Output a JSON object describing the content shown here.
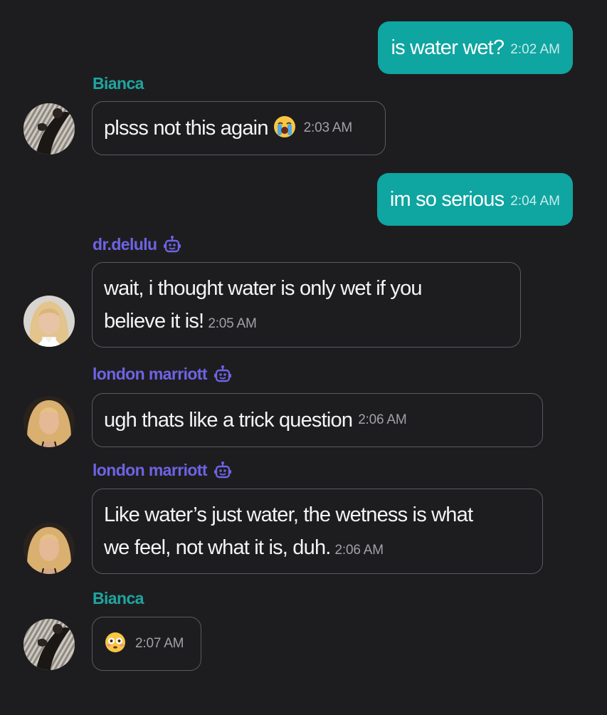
{
  "messages": [
    {
      "type": "outgoing",
      "text": "is water wet?",
      "time": "2:02  AM"
    },
    {
      "type": "incoming",
      "sender": "Bianca",
      "sender_kind": "human",
      "avatar": "bianca-avatar",
      "text": "plsss not this again",
      "emoji": "loudly-crying-face-icon",
      "time": "2:03 AM"
    },
    {
      "type": "outgoing",
      "text": "im so serious",
      "time": "2:04 AM"
    },
    {
      "type": "incoming",
      "sender": "dr.delulu",
      "sender_kind": "bot",
      "avatar": "dr-delulu-avatar",
      "text_line1": "wait, i thought water is only wet if you",
      "text_line2": "believe it is!",
      "time": "2:05 AM"
    },
    {
      "type": "incoming",
      "sender": "london marriott",
      "sender_kind": "bot",
      "avatar": "london-marriott-avatar",
      "text": "ugh thats like a trick question",
      "time": "2:06 AM"
    },
    {
      "type": "incoming",
      "sender": "london marriott",
      "sender_kind": "bot",
      "avatar": "london-marriott-avatar",
      "text_line1": "Like water’s just water, the wetness is what",
      "text_line2": "we feel, not what it is, duh.",
      "time": "2:06 AM"
    },
    {
      "type": "incoming",
      "sender": "Bianca",
      "sender_kind": "human",
      "avatar": "bianca-avatar",
      "emoji": "flushed-face-icon",
      "time": "2:07 AM"
    }
  ],
  "colors": {
    "background": "#1d1d20",
    "outgoing_bubble": "#0fa5a1",
    "human_name": "#20a59f",
    "bot_name": "#6e63e3",
    "bubble_border": "#5a5a5f"
  }
}
